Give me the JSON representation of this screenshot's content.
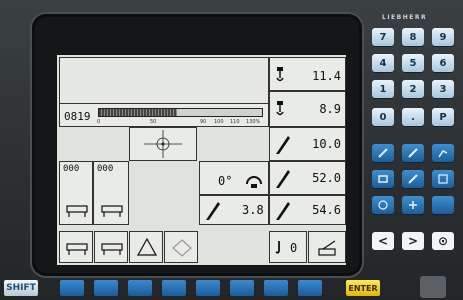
{
  "brand": "LIEBHERR",
  "keypad": {
    "keys": [
      "7",
      "8",
      "9",
      "4",
      "5",
      "6",
      "1",
      "2",
      "3",
      "0",
      ".",
      "P"
    ],
    "nav": [
      "<",
      ">",
      "⊙"
    ]
  },
  "bottom": {
    "shift": "SHIFT",
    "enter": "ENTER"
  },
  "lcd": {
    "bar_display": {
      "value": "0819",
      "scale": [
        "0",
        "50",
        "90",
        "100",
        "110",
        "130%"
      ]
    },
    "right_panel": [
      {
        "value": "11.4",
        "icon": "hook-load-icon"
      },
      {
        "value": "8.9",
        "icon": "hook-load-icon"
      },
      {
        "value": "10.0",
        "icon": "boom-angle-icon"
      },
      {
        "value": "52.0",
        "icon": "boom-length-icon"
      },
      {
        "value": "54.6",
        "icon": "radius-icon"
      }
    ],
    "slew": "0°",
    "angle_value": "3.8",
    "counters": [
      "000",
      "000"
    ],
    "hook_count": "0"
  }
}
